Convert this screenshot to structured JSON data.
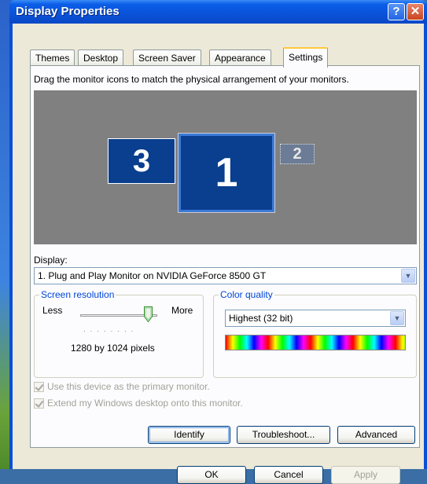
{
  "window": {
    "title": "Display Properties"
  },
  "titlebar": {
    "help_glyph": "?",
    "close_glyph": "✕"
  },
  "tabs": [
    {
      "label": "Themes"
    },
    {
      "label": "Desktop"
    },
    {
      "label": "Screen Saver"
    },
    {
      "label": "Appearance"
    },
    {
      "label": "Settings"
    }
  ],
  "settings": {
    "instruction": "Drag the monitor icons to match the physical arrangement of your monitors.",
    "monitors": [
      {
        "label": "3"
      },
      {
        "label": "1"
      },
      {
        "label": "2"
      }
    ],
    "display_label": "Display:",
    "display_value": "1. Plug and Play Monitor on NVIDIA GeForce 8500 GT",
    "resolution": {
      "legend": "Screen resolution",
      "less": "Less",
      "more": "More",
      "value_text": "1280 by 1024 pixels",
      "slider_position": 0.85
    },
    "color": {
      "legend": "Color quality",
      "value": "Highest (32 bit)"
    },
    "checkboxes": [
      {
        "label": "Use this device as the primary monitor.",
        "checked": true,
        "enabled": false
      },
      {
        "label": "Extend my Windows desktop onto this monitor.",
        "checked": true,
        "enabled": false
      }
    ],
    "buttons": {
      "identify": "Identify",
      "troubleshoot": "Troubleshoot...",
      "advanced": "Advanced"
    }
  },
  "footer": {
    "ok": "OK",
    "cancel": "Cancel",
    "apply": "Apply"
  },
  "colors": {
    "titlebar": "#0a52d8",
    "monitor_background": "#808080",
    "monitor_fill": "#0a3e8e",
    "group_legend": "#0046d5"
  }
}
